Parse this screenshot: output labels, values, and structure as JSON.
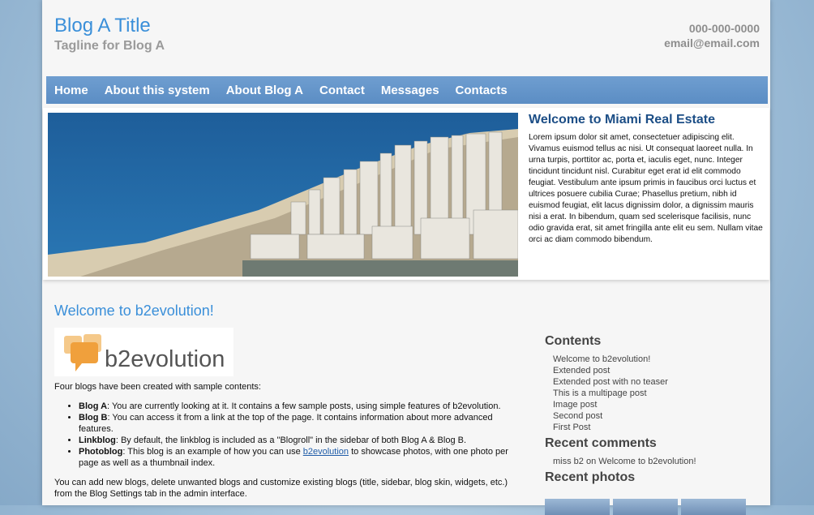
{
  "header": {
    "title": "Blog A Title",
    "tagline": "Tagline for Blog A",
    "phone": "000-000-0000",
    "email": "email@email.com"
  },
  "nav": {
    "items": [
      "Home",
      "About this system",
      "About Blog A",
      "Contact",
      "Messages",
      "Contacts"
    ]
  },
  "hero": {
    "heading": "Welcome to Miami Real Estate",
    "paragraph": "Lorem ipsum dolor sit amet, consectetuer adipiscing elit. Vivamus euismod tellus ac nisi. Ut consequat laoreet nulla. In urna turpis, porttitor ac, porta et, iaculis eget, nunc. Integer tincidunt tincidunt nisl. Curabitur eget erat id elit commodo feugiat. Vestibulum ante ipsum primis in faucibus orci luctus et ultrices posuere cubilia Curae; Phasellus pretium, nibh id euismod feugiat, elit lacus dignissim dolor, a dignissim mauris nisi a erat. In bibendum, quam sed scelerisque facilisis, nunc odio gravida erat, sit amet fringilla ante elit eu sem. Nullam vitae orci ac diam commodo bibendum."
  },
  "post": {
    "title": "Welcome to b2evolution!",
    "logo_text": "b2evolution",
    "intro": "Four blogs have been created with sample contents:",
    "blogs": [
      {
        "name": "Blog A",
        "text": ": You are currently looking at it. It contains a few sample posts, using simple features of b2evolution."
      },
      {
        "name": "Blog B",
        "text": ": You can access it from a link at the top of the page. It contains information about more advanced features."
      },
      {
        "name": "Linkblog",
        "text": ": By default, the linkblog is included as a \"Blogroll\" in the sidebar of both Blog A & Blog B."
      },
      {
        "name": "Photoblog",
        "text_before": ": This blog is an example of how you can use ",
        "link": "b2evolution",
        "text_after": " to showcase photos, with one photo per page as well as a thumbnail index."
      }
    ],
    "outro": "You can add new blogs, delete unwanted blogs and customize existing blogs (title, sidebar, blog skin, widgets, etc.) from the Blog Settings tab in the admin interface."
  },
  "sidebar": {
    "contents_title": "Contents",
    "contents_items": [
      "Welcome to b2evolution!",
      "Extended post",
      "Extended post with no teaser",
      "This is a multipage post",
      "Image post",
      "Second post",
      "First Post"
    ],
    "comments_title": "Recent comments",
    "comment": {
      "author": "miss b2",
      "on": "on",
      "post": "Welcome to b2evolution!"
    },
    "photos_title": "Recent photos"
  },
  "colors": {
    "accent": "#3a8fd9",
    "nav_bg": "#6497cb",
    "hero_heading": "#1c4e86"
  }
}
